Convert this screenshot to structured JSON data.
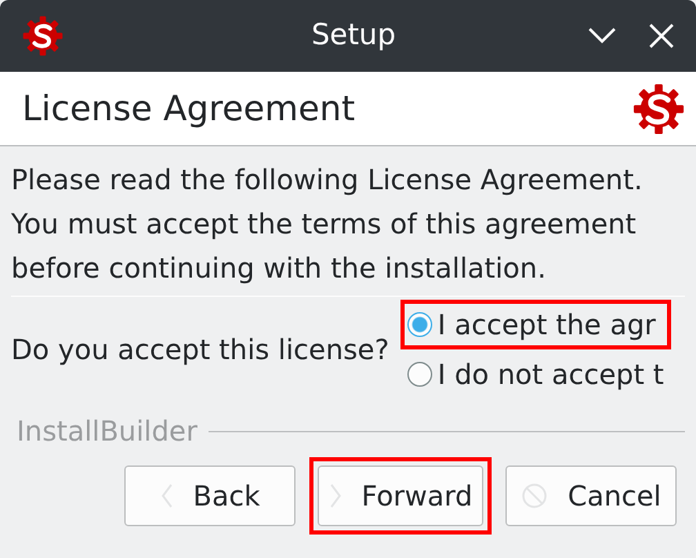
{
  "window": {
    "title": "Setup"
  },
  "header": {
    "title": "License Agreement"
  },
  "intro": "Please read the following License Agreement. You must accept the terms of this agreement before continuing with the installation.",
  "question": "Do you accept this license?",
  "options": [
    {
      "label": "I accept the agr",
      "selected": true,
      "highlighted": true
    },
    {
      "label": "I do not accept t",
      "selected": false,
      "highlighted": false
    }
  ],
  "branding": "InstallBuilder",
  "buttons": [
    {
      "label": "Back",
      "kind": "back",
      "highlighted": false
    },
    {
      "label": "Forward",
      "kind": "forward",
      "highlighted": true
    },
    {
      "label": "Cancel",
      "kind": "cancel",
      "highlighted": false
    }
  ]
}
